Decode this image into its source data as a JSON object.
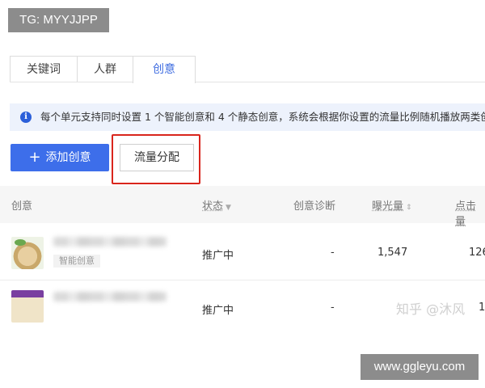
{
  "watermark_top": "TG: MYYJJPP",
  "watermark_bottom": "www.ggleyu.com",
  "tabs": [
    {
      "label": "关键词"
    },
    {
      "label": "人群"
    },
    {
      "label": "创意"
    }
  ],
  "info_text": "每个单元支持同时设置 1 个智能创意和 4 个静态创意，系统会根据你设置的流量比例随机播放两类创",
  "buttons": {
    "add_label": "添加创意",
    "flow_label": "流量分配"
  },
  "table": {
    "headers": {
      "creative": "创意",
      "status": "状态",
      "diagnosis": "创意诊断",
      "impressions": "曝光量",
      "clicks": "点击量"
    },
    "rows": [
      {
        "tag": "智能创意",
        "status": "推广中",
        "diagnosis": "-",
        "impressions": "1,547",
        "clicks": "126"
      },
      {
        "tag": "",
        "status": "推广中",
        "diagnosis": "-",
        "impressions": "",
        "clicks": "1"
      }
    ]
  },
  "zhihu_watermark": "知乎 @沐风",
  "colors": {
    "accent": "#3d6eea",
    "highlight": "#d9251c",
    "info_bg": "#edf2fc"
  }
}
